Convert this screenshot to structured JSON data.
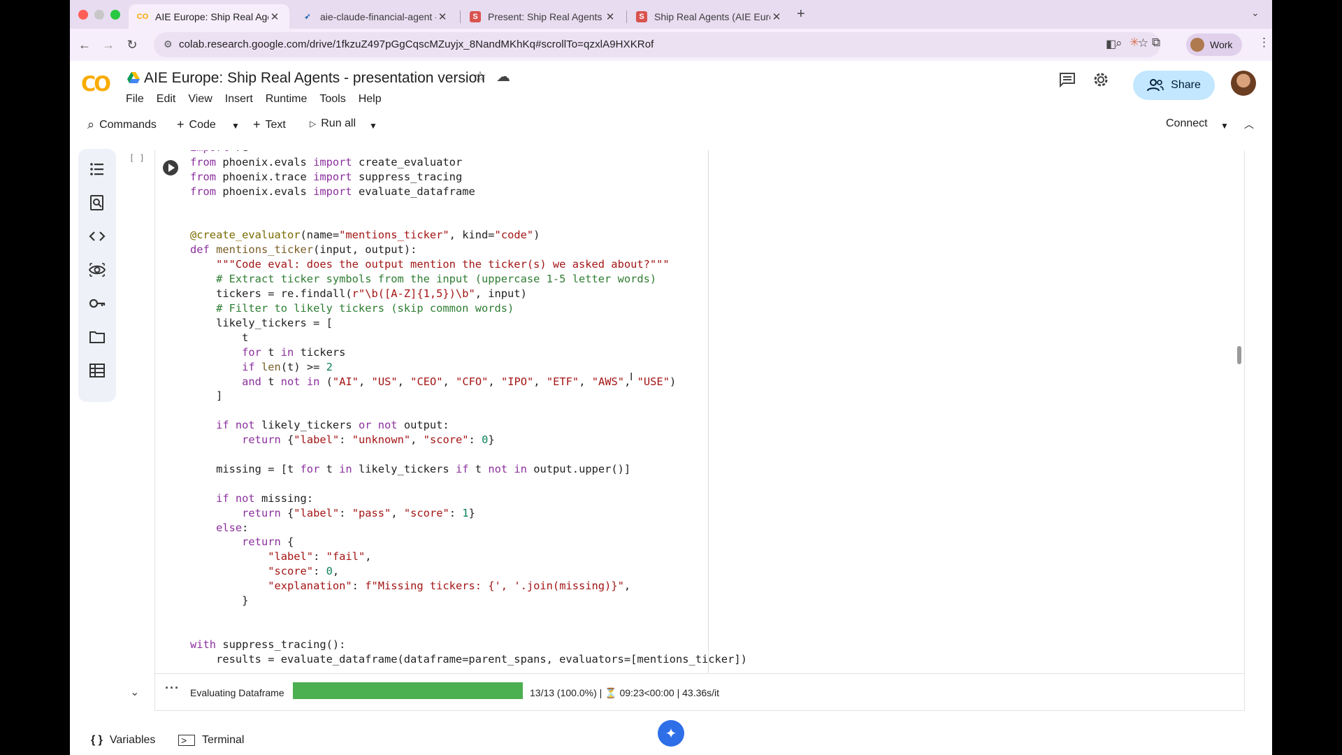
{
  "browser": {
    "tabs": [
      {
        "title": "AIE Europe: Ship Real Agents",
        "favicon": "colab-icon",
        "active": true
      },
      {
        "title": "aie-claude-financial-agent - ",
        "favicon": "phoenix-icon",
        "active": false
      },
      {
        "title": "Present: Ship Real Agents (A",
        "favicon": "slides-icon",
        "active": false
      },
      {
        "title": "Ship Real Agents (AIE Europe",
        "favicon": "slides-icon",
        "active": false
      }
    ],
    "url": "colab.research.google.com/drive/1fkzuZ497pGgCqscMZuyjx_8NandMKhKq#scrollTo=qzxlA9HXKRof",
    "profile_label": "Work"
  },
  "colab": {
    "logo_text": "CO",
    "title": "AIE Europe: Ship Real Agents - presentation version",
    "menu": [
      "File",
      "Edit",
      "View",
      "Insert",
      "Runtime",
      "Tools",
      "Help"
    ],
    "share_label": "Share"
  },
  "cell_toolbar": {
    "commands": "Commands",
    "code": "Code",
    "text": "Text",
    "run_all": "Run all",
    "connect": "Connect"
  },
  "cell": {
    "exec_count": "[ ]"
  },
  "output": {
    "label": "Evaluating Dataframe",
    "progress_fraction": 1.0,
    "stats": "13/13 (100.0%) | ⏳ 09:23<00:00 | 43.36s/it"
  },
  "bottom": {
    "variables": "Variables",
    "terminal": "Terminal"
  },
  "colors": {
    "accent": "#c2e7ff",
    "progress": "#4caf50"
  }
}
